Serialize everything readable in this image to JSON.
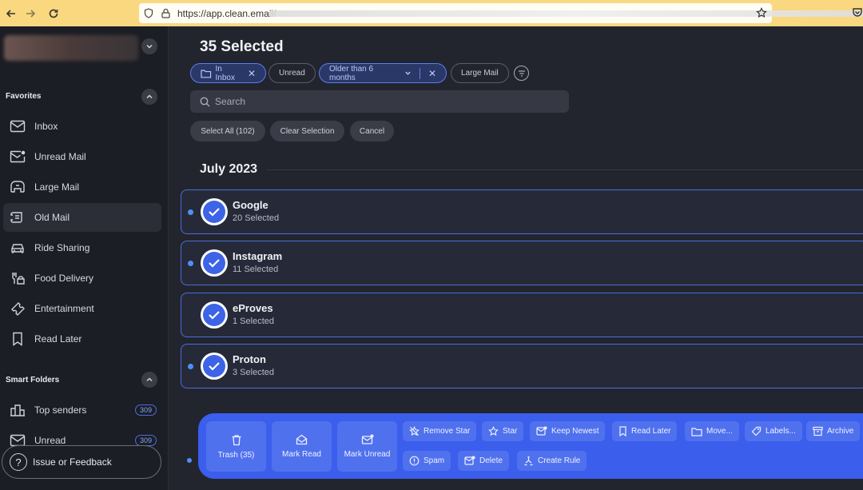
{
  "browser": {
    "url": "https://app.clean.email/"
  },
  "sidebar": {
    "favorites_title": "Favorites",
    "favorites": [
      {
        "label": "Inbox",
        "icon": "inbox-icon"
      },
      {
        "label": "Unread Mail",
        "icon": "unread-mail-icon"
      },
      {
        "label": "Large Mail",
        "icon": "large-mail-icon"
      },
      {
        "label": "Old Mail",
        "icon": "old-mail-icon"
      },
      {
        "label": "Ride Sharing",
        "icon": "car-icon"
      },
      {
        "label": "Food Delivery",
        "icon": "food-icon"
      },
      {
        "label": "Entertainment",
        "icon": "ticket-icon"
      },
      {
        "label": "Read Later",
        "icon": "bookmark-icon"
      }
    ],
    "smart_title": "Smart Folders",
    "smart": [
      {
        "label": "Top senders",
        "badge": "309"
      },
      {
        "label": "Unread",
        "badge": "309"
      }
    ],
    "feedback_label": "Issue or Feedback"
  },
  "main": {
    "title": "35 Selected",
    "chips": {
      "inbox": "In Inbox",
      "unread": "Unread",
      "older": "Older than 6 months",
      "large": "Large Mail"
    },
    "search_placeholder": "Search",
    "buttons": {
      "select_all": "Select All (102)",
      "clear": "Clear Selection",
      "cancel": "Cancel"
    },
    "month": "July 2023",
    "groups": [
      {
        "name": "Google",
        "count": "20 Selected"
      },
      {
        "name": "Instagram",
        "count": "11 Selected"
      },
      {
        "name": "eProves",
        "count": "1 Selected"
      },
      {
        "name": "Proton",
        "count": "3 Selected"
      }
    ]
  },
  "actions": {
    "trash": "Trash (35)",
    "mark_read": "Mark Read",
    "mark_unread": "Mark Unread",
    "remove_star": "Remove Star",
    "star": "Star",
    "keep_newest": "Keep Newest",
    "read_later": "Read Later",
    "move": "Move...",
    "labels": "Labels...",
    "archive": "Archive",
    "spam": "Spam",
    "delete": "Delete",
    "create_rule": "Create Rule"
  },
  "colors": {
    "accent": "#3b5eec",
    "sidebar_bg": "#1c1e25",
    "main_bg": "#22252e",
    "browser_bar": "#f9d880"
  }
}
